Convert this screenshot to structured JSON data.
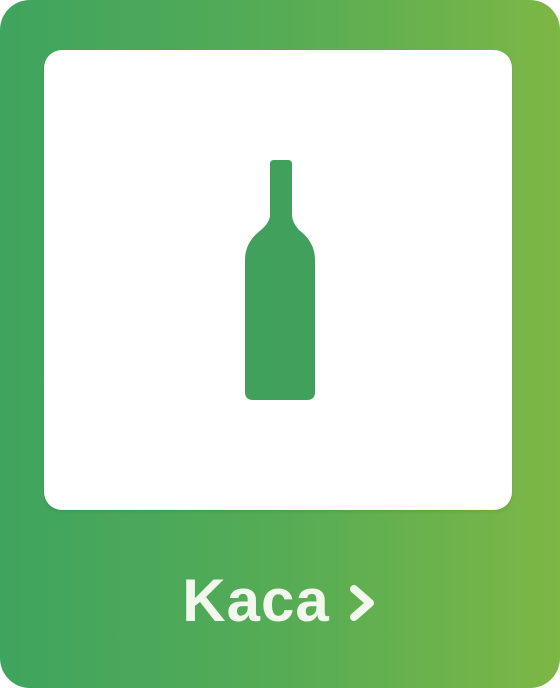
{
  "tile": {
    "label": "Kaca",
    "icon": "bottle-icon",
    "chevron_icon": "chevron-right-icon"
  },
  "colors": {
    "gradient_start": "#3fa45f",
    "gradient_end": "#7db745",
    "bottle": "#40a05c",
    "label": "#f3f8ef"
  }
}
